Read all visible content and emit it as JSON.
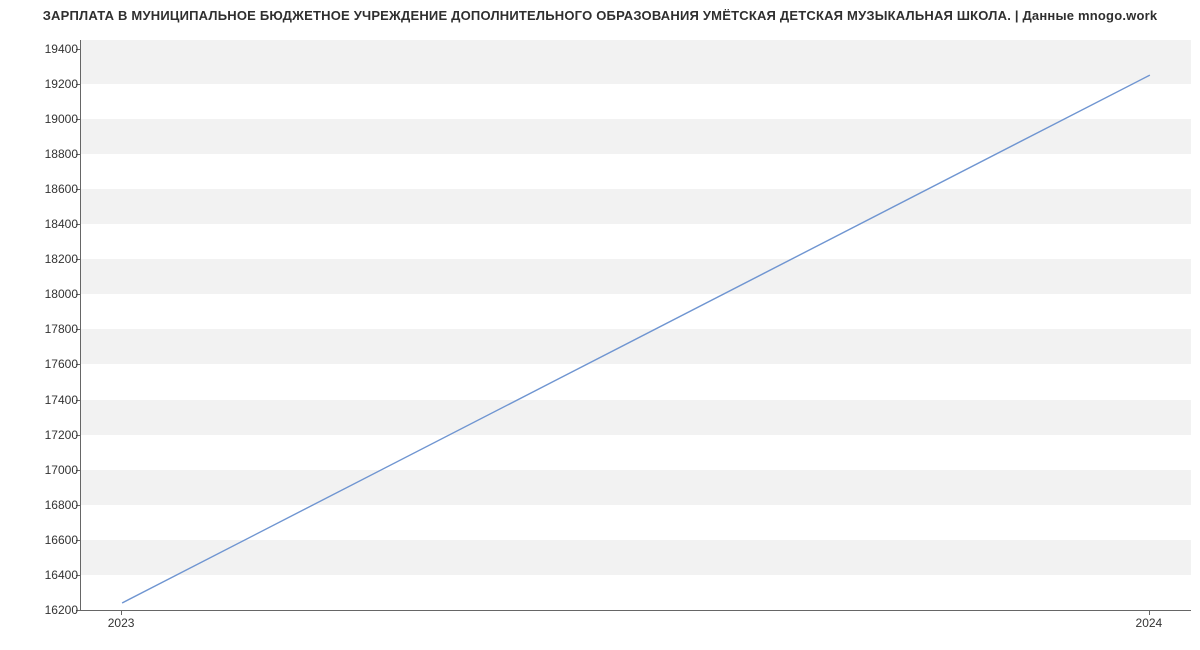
{
  "chart_data": {
    "type": "line",
    "title": "ЗАРПЛАТА В МУНИЦИПАЛЬНОЕ БЮДЖЕТНОЕ УЧРЕЖДЕНИЕ ДОПОЛНИТЕЛЬНОГО ОБРАЗОВАНИЯ  УМЁТСКАЯ ДЕТСКАЯ МУЗЫКАЛЬНАЯ ШКОЛА. | Данные mnogo.work",
    "x": [
      2023,
      2024
    ],
    "values": [
      16240,
      19250
    ],
    "x_tick_labels": [
      "2023",
      "2024"
    ],
    "y_ticks": [
      16200,
      16400,
      16600,
      16800,
      17000,
      17200,
      17400,
      17600,
      17800,
      18000,
      18200,
      18400,
      18600,
      18800,
      19000,
      19200,
      19400
    ],
    "ylim": [
      16200,
      19450
    ],
    "xlim": [
      2022.96,
      2024.04
    ],
    "xlabel": "",
    "ylabel": "",
    "line_color": "#6f95d1"
  }
}
